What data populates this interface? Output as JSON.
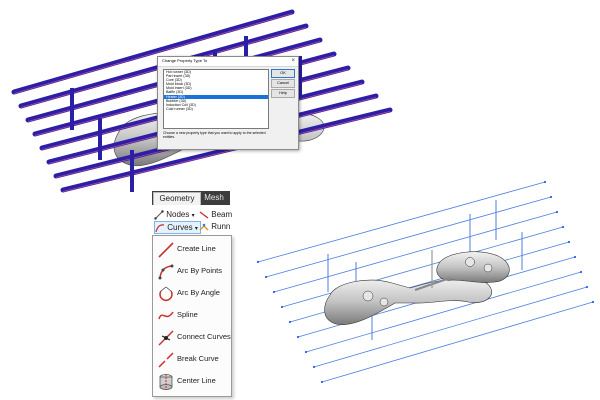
{
  "dialog": {
    "title": "Change Property Type To",
    "close_glyph": "×",
    "items": [
      "Hot runner (3D)",
      "Part insert (3D)",
      "Core (3D)",
      "Mold block (3D)",
      "Mold insert (3D)",
      "Baffle (3D)",
      "Heater (3D)",
      "Bubbler (3D)",
      "Induction Coil (3D)",
      "Cold runner (3D)"
    ],
    "selected_index": 6,
    "buttons": {
      "ok": "OK",
      "cancel": "Cancel",
      "help": "Help"
    },
    "hint": "Choose a new property type that you want to apply to the selected entities."
  },
  "ribbon": {
    "tabs": {
      "geometry": "Geometry",
      "mesh": "Mesh"
    },
    "tools": {
      "nodes": "Nodes",
      "beam": "Beam",
      "curves": "Curves",
      "run": "Runn"
    },
    "dropdown_glyph": "▾",
    "menu": [
      {
        "label": "Create Line",
        "icon": "create-line-icon"
      },
      {
        "label": "Arc By Points",
        "icon": "arc-by-points-icon"
      },
      {
        "label": "Arc By Angle",
        "icon": "arc-by-angle-icon"
      },
      {
        "label": "Spline",
        "icon": "spline-icon"
      },
      {
        "label": "Connect Curves",
        "icon": "connect-curves-icon"
      },
      {
        "label": "Break Curve",
        "icon": "break-curve-icon"
      },
      {
        "label": "Center Line",
        "icon": "center-line-icon"
      }
    ]
  },
  "colors": {
    "pipe": "#2a1fa6",
    "pipe_stripe": "#e05090",
    "wire": "#4d7fe0",
    "wire_node": "#2f5fe0",
    "menu_icon_red": "#c8312f"
  }
}
